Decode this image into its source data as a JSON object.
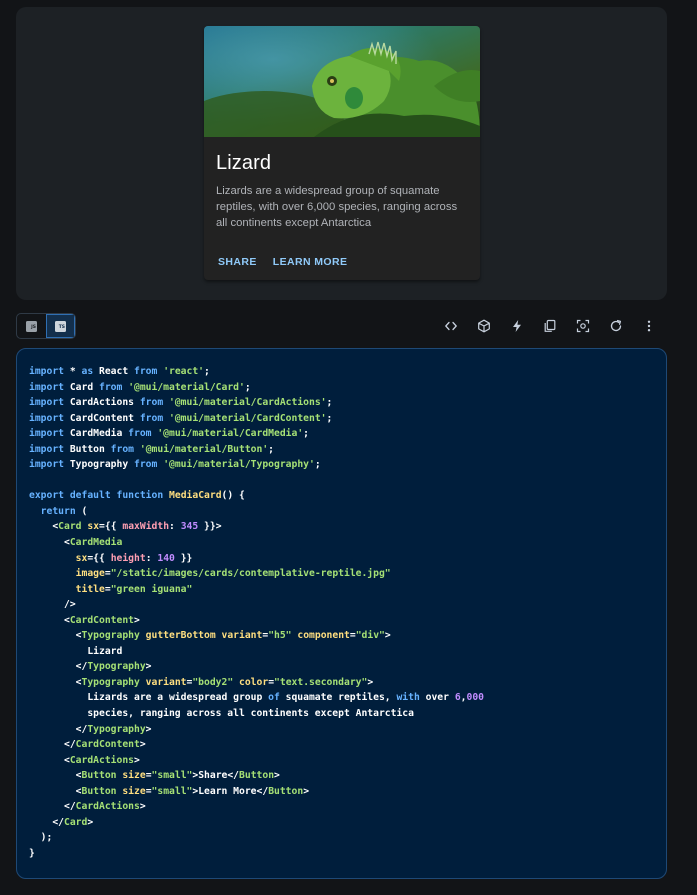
{
  "demo": {
    "card": {
      "image_alt": "green iguana",
      "title": "Lizard",
      "body": "Lizards are a widespread group of squamate reptiles, with over 6,000 species, ranging across all continents except Antarctica",
      "actions": [
        {
          "label": "SHARE"
        },
        {
          "label": "LEARN MORE"
        }
      ]
    }
  },
  "toolbar": {
    "language_toggle": [
      {
        "label": "JS",
        "selected": false
      },
      {
        "label": "TS",
        "selected": true
      }
    ],
    "icons": [
      "code-icon",
      "codesandbox-icon",
      "stackblitz-bolt-icon",
      "copy-icon",
      "reset-focus-icon",
      "reset-demo-icon",
      "more-vert-icon"
    ]
  },
  "colors": {
    "page_bg": "#121417",
    "demo_bg": "#1d2125",
    "card_bg": "#222222",
    "code_bg": "#001e3c",
    "button_text": "#90caf9"
  },
  "code_lines": [
    [
      [
        "keyword",
        "import"
      ],
      [
        "plain",
        " * "
      ],
      [
        "keyword",
        "as"
      ],
      [
        "plain",
        " React "
      ],
      [
        "keyword",
        "from"
      ],
      [
        "plain",
        " "
      ],
      [
        "string",
        "'react'"
      ],
      [
        "plain",
        ";"
      ]
    ],
    [
      [
        "keyword",
        "import"
      ],
      [
        "plain",
        " Card "
      ],
      [
        "keyword",
        "from"
      ],
      [
        "plain",
        " "
      ],
      [
        "string",
        "'@mui/material/Card'"
      ],
      [
        "plain",
        ";"
      ]
    ],
    [
      [
        "keyword",
        "import"
      ],
      [
        "plain",
        " CardActions "
      ],
      [
        "keyword",
        "from"
      ],
      [
        "plain",
        " "
      ],
      [
        "string",
        "'@mui/material/CardActions'"
      ],
      [
        "plain",
        ";"
      ]
    ],
    [
      [
        "keyword",
        "import"
      ],
      [
        "plain",
        " CardContent "
      ],
      [
        "keyword",
        "from"
      ],
      [
        "plain",
        " "
      ],
      [
        "string",
        "'@mui/material/CardContent'"
      ],
      [
        "plain",
        ";"
      ]
    ],
    [
      [
        "keyword",
        "import"
      ],
      [
        "plain",
        " CardMedia "
      ],
      [
        "keyword",
        "from"
      ],
      [
        "plain",
        " "
      ],
      [
        "string",
        "'@mui/material/CardMedia'"
      ],
      [
        "plain",
        ";"
      ]
    ],
    [
      [
        "keyword",
        "import"
      ],
      [
        "plain",
        " Button "
      ],
      [
        "keyword",
        "from"
      ],
      [
        "plain",
        " "
      ],
      [
        "string",
        "'@mui/material/Button'"
      ],
      [
        "plain",
        ";"
      ]
    ],
    [
      [
        "keyword",
        "import"
      ],
      [
        "plain",
        " Typography "
      ],
      [
        "keyword",
        "from"
      ],
      [
        "plain",
        " "
      ],
      [
        "string",
        "'@mui/material/Typography'"
      ],
      [
        "plain",
        ";"
      ]
    ],
    [],
    [
      [
        "keyword",
        "export"
      ],
      [
        "plain",
        " "
      ],
      [
        "keyword",
        "default"
      ],
      [
        "plain",
        " "
      ],
      [
        "keyword",
        "function"
      ],
      [
        "plain",
        " "
      ],
      [
        "func",
        "MediaCard"
      ],
      [
        "plain",
        "() {"
      ]
    ],
    [
      [
        "plain",
        "  "
      ],
      [
        "keyword",
        "return"
      ],
      [
        "plain",
        " ("
      ]
    ],
    [
      [
        "plain",
        "    <"
      ],
      [
        "tag",
        "Card"
      ],
      [
        "plain",
        " "
      ],
      [
        "attr",
        "sx"
      ],
      [
        "plain",
        "={{ "
      ],
      [
        "prop",
        "maxWidth"
      ],
      [
        "plain",
        ": "
      ],
      [
        "number",
        "345"
      ],
      [
        "plain",
        " }}>"
      ]
    ],
    [
      [
        "plain",
        "      <"
      ],
      [
        "tag",
        "CardMedia"
      ]
    ],
    [
      [
        "plain",
        "        "
      ],
      [
        "attr",
        "sx"
      ],
      [
        "plain",
        "={{ "
      ],
      [
        "prop",
        "height"
      ],
      [
        "plain",
        ": "
      ],
      [
        "number",
        "140"
      ],
      [
        "plain",
        " }}"
      ]
    ],
    [
      [
        "plain",
        "        "
      ],
      [
        "attr",
        "image"
      ],
      [
        "plain",
        "="
      ],
      [
        "string",
        "\"/static/images/cards/contemplative-reptile.jpg\""
      ]
    ],
    [
      [
        "plain",
        "        "
      ],
      [
        "attr",
        "title"
      ],
      [
        "plain",
        "="
      ],
      [
        "string",
        "\"green iguana\""
      ]
    ],
    [
      [
        "plain",
        "      />"
      ]
    ],
    [
      [
        "plain",
        "      <"
      ],
      [
        "tag",
        "CardContent"
      ],
      [
        "plain",
        ">"
      ]
    ],
    [
      [
        "plain",
        "        <"
      ],
      [
        "tag",
        "Typography"
      ],
      [
        "plain",
        " "
      ],
      [
        "attr",
        "gutterBottom"
      ],
      [
        "plain",
        " "
      ],
      [
        "attr",
        "variant"
      ],
      [
        "plain",
        "="
      ],
      [
        "string",
        "\"h5\""
      ],
      [
        "plain",
        " "
      ],
      [
        "attr",
        "component"
      ],
      [
        "plain",
        "="
      ],
      [
        "string",
        "\"div\""
      ],
      [
        "plain",
        ">"
      ]
    ],
    [
      [
        "plain",
        "          Lizard"
      ]
    ],
    [
      [
        "plain",
        "        </"
      ],
      [
        "tag",
        "Typography"
      ],
      [
        "plain",
        ">"
      ]
    ],
    [
      [
        "plain",
        "        <"
      ],
      [
        "tag",
        "Typography"
      ],
      [
        "plain",
        " "
      ],
      [
        "attr",
        "variant"
      ],
      [
        "plain",
        "="
      ],
      [
        "string",
        "\"body2\""
      ],
      [
        "plain",
        " "
      ],
      [
        "attr",
        "color"
      ],
      [
        "plain",
        "="
      ],
      [
        "string",
        "\"text.secondary\""
      ],
      [
        "plain",
        ">"
      ]
    ],
    [
      [
        "plain",
        "          Lizards are a widespread group "
      ],
      [
        "keyword",
        "of"
      ],
      [
        "plain",
        " squamate reptiles, "
      ],
      [
        "keyword",
        "with"
      ],
      [
        "plain",
        " over "
      ],
      [
        "number",
        "6"
      ],
      [
        "plain",
        ","
      ],
      [
        "number",
        "000"
      ]
    ],
    [
      [
        "plain",
        "          species, ranging across all continents except Antarctica"
      ]
    ],
    [
      [
        "plain",
        "        </"
      ],
      [
        "tag",
        "Typography"
      ],
      [
        "plain",
        ">"
      ]
    ],
    [
      [
        "plain",
        "      </"
      ],
      [
        "tag",
        "CardContent"
      ],
      [
        "plain",
        ">"
      ]
    ],
    [
      [
        "plain",
        "      <"
      ],
      [
        "tag",
        "CardActions"
      ],
      [
        "plain",
        ">"
      ]
    ],
    [
      [
        "plain",
        "        <"
      ],
      [
        "tag",
        "Button"
      ],
      [
        "plain",
        " "
      ],
      [
        "attr",
        "size"
      ],
      [
        "plain",
        "="
      ],
      [
        "string",
        "\"small\""
      ],
      [
        "plain",
        ">Share</"
      ],
      [
        "tag",
        "Button"
      ],
      [
        "plain",
        ">"
      ]
    ],
    [
      [
        "plain",
        "        <"
      ],
      [
        "tag",
        "Button"
      ],
      [
        "plain",
        " "
      ],
      [
        "attr",
        "size"
      ],
      [
        "plain",
        "="
      ],
      [
        "string",
        "\"small\""
      ],
      [
        "plain",
        ">Learn More</"
      ],
      [
        "tag",
        "Button"
      ],
      [
        "plain",
        ">"
      ]
    ],
    [
      [
        "plain",
        "      </"
      ],
      [
        "tag",
        "CardActions"
      ],
      [
        "plain",
        ">"
      ]
    ],
    [
      [
        "plain",
        "    </"
      ],
      [
        "tag",
        "Card"
      ],
      [
        "plain",
        ">"
      ]
    ],
    [
      [
        "plain",
        "  );"
      ]
    ],
    [
      [
        "plain",
        "}"
      ]
    ]
  ]
}
